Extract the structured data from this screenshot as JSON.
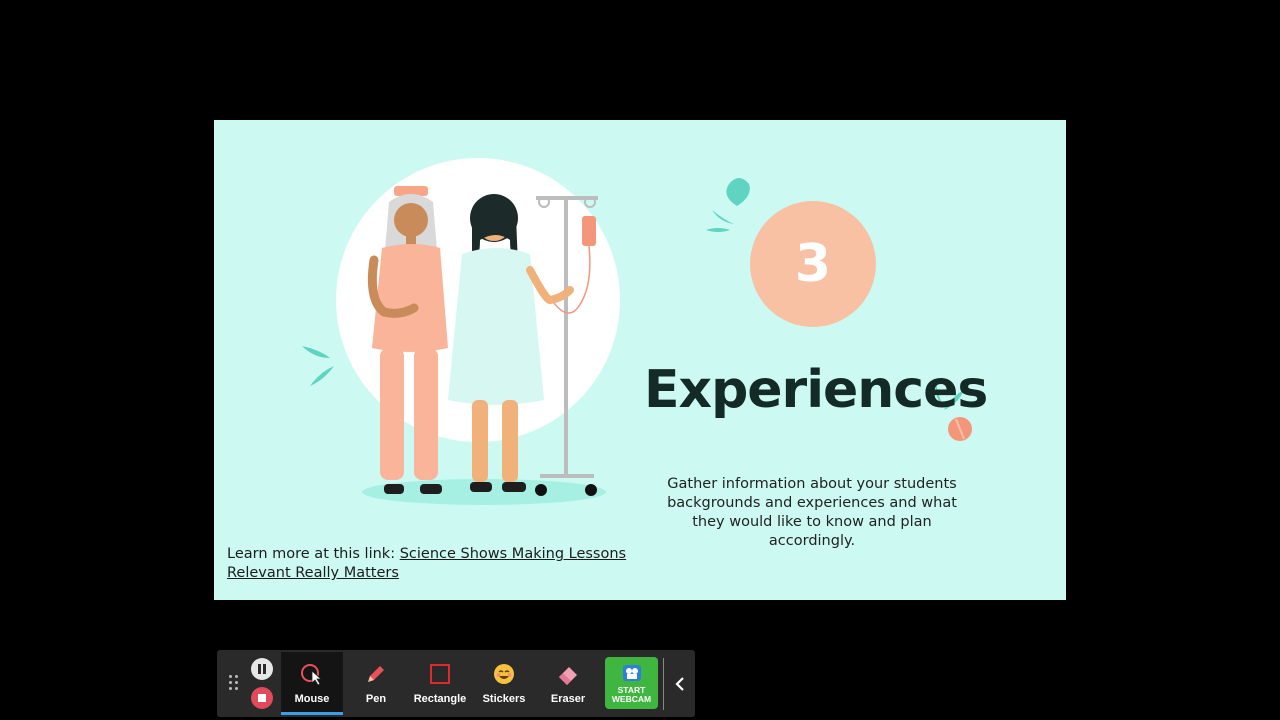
{
  "slide": {
    "number": "3",
    "title": "Experiences",
    "body": "Gather information about your students backgrounds and experiences and what they would like to know and plan accordingly.",
    "footer_prefix": "Learn more at this link: ",
    "footer_link": "Science Shows Making Lessons Relevant Really Matters",
    "colors": {
      "background": "#ccfaf2",
      "circle": "#f9c1a4",
      "title": "#132a26"
    }
  },
  "toolbar": {
    "tools": [
      {
        "label": "Mouse",
        "icon": "mouse-cursor-icon",
        "active": true
      },
      {
        "label": "Pen",
        "icon": "pen-icon",
        "active": false
      },
      {
        "label": "Rectangle",
        "icon": "rectangle-icon",
        "active": false
      },
      {
        "label": "Stickers",
        "icon": "sticker-icon",
        "active": false
      },
      {
        "label": "Eraser",
        "icon": "eraser-icon",
        "active": false
      }
    ],
    "webcam_label_line1": "START",
    "webcam_label_line2": "WEBCAM",
    "colors": {
      "background": "#2a2a2a",
      "active_underline": "#3aa0e8",
      "webcam": "#3fb63f",
      "stop": "#e04a5a"
    }
  }
}
